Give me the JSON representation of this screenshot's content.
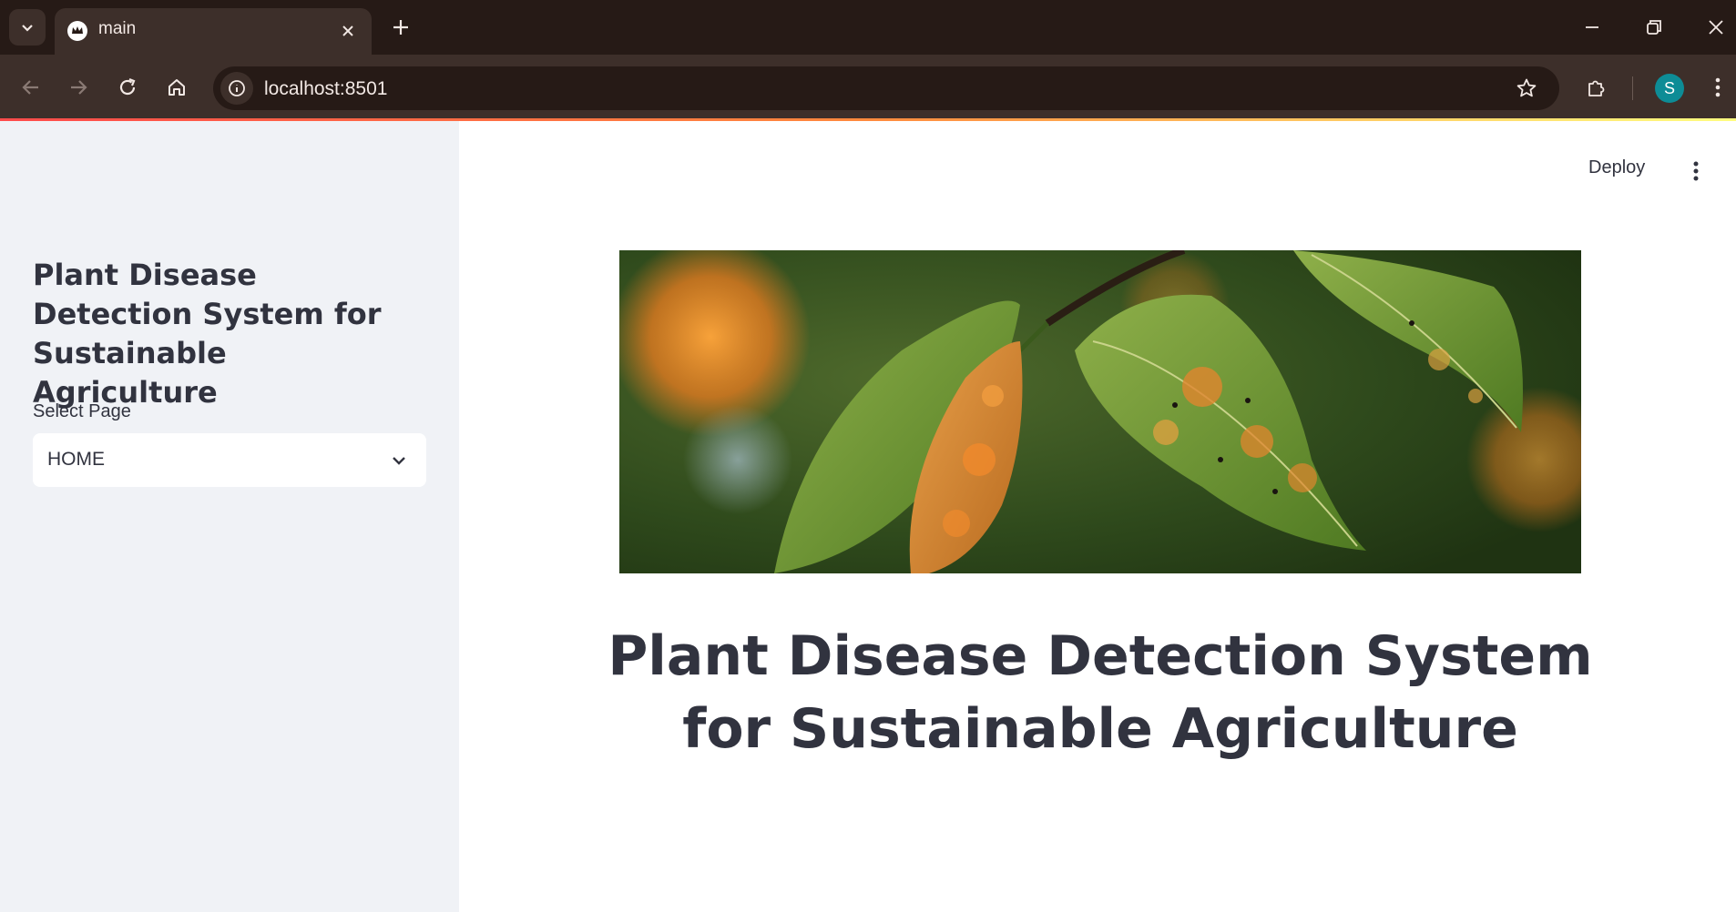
{
  "browser": {
    "tab_title": "main",
    "url": "localhost:8501",
    "profile_initial": "S"
  },
  "app": {
    "header": {
      "deploy_label": "Deploy"
    },
    "sidebar": {
      "title": "Plant Disease Detection System for Sustainable Agriculture",
      "select_label": "Select Page",
      "select_value": "HOME"
    },
    "main": {
      "title": "Plant Disease Detection System for Sustainable Agriculture"
    }
  },
  "icons": {
    "tab_search": "chevron-down-icon",
    "close_tab": "close-icon",
    "new_tab": "plus-icon",
    "back": "arrow-left-icon",
    "forward": "arrow-right-icon",
    "reload": "reload-icon",
    "home": "home-icon",
    "site_info": "info-icon",
    "bookmark": "star-icon",
    "extensions": "puzzle-icon",
    "browser_menu": "kebab-icon",
    "app_menu": "kebab-icon"
  },
  "colors": {
    "chrome_dark": "#261a16",
    "chrome_mid": "#3d2f2a",
    "sidebar_bg": "#f0f2f6",
    "text": "#31333f",
    "profile": "#0d8c96"
  }
}
